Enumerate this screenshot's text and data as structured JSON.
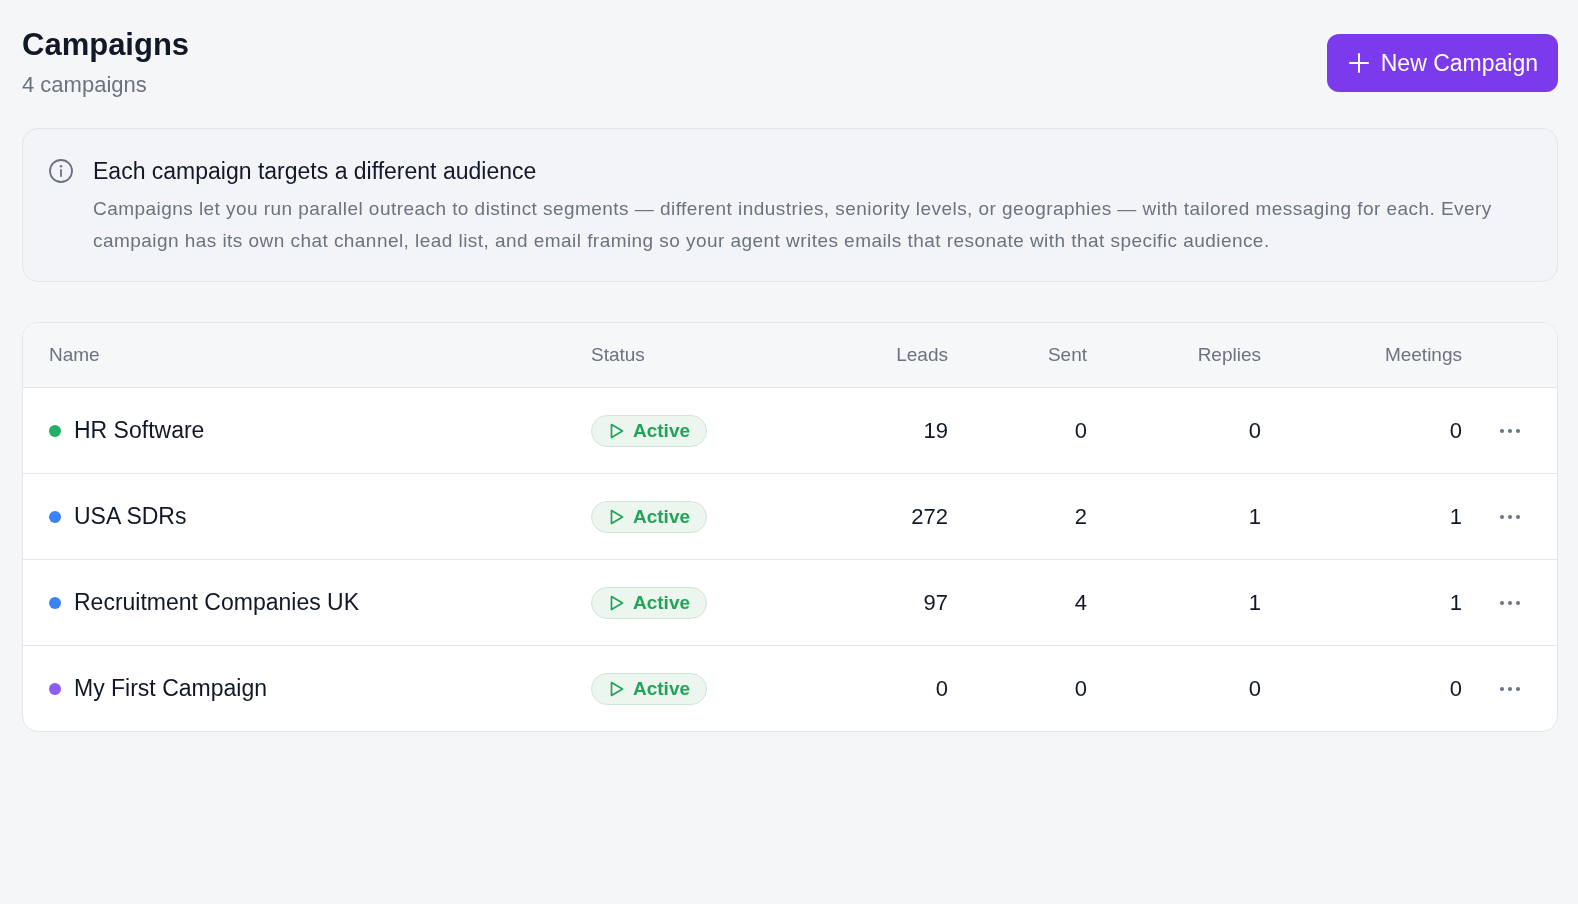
{
  "header": {
    "title": "Campaigns",
    "subtitle": "4 campaigns",
    "new_button": {
      "label": "New Campaign"
    }
  },
  "info_card": {
    "title": "Each campaign targets a different audience",
    "body": "Campaigns let you run parallel outreach to distinct segments — different industries, seniority levels, or geographies — with tailored messaging for each. Every campaign has its own chat channel, lead list, and email framing so your agent writes emails that resonate with that specific audience."
  },
  "table": {
    "columns": [
      "Name",
      "Status",
      "Leads",
      "Sent",
      "Replies",
      "Meetings"
    ],
    "rows": [
      {
        "name": "HR Software",
        "color": "#22b067",
        "status": {
          "kind": "active",
          "label": "Active"
        },
        "leads": "19",
        "sent": "0",
        "replies": "0",
        "meetings": "0"
      },
      {
        "name": "USA SDRs",
        "color": "#3b82f6",
        "status": {
          "kind": "active",
          "label": "Active"
        },
        "leads": "272",
        "sent": "2",
        "replies": "1",
        "meetings": "1"
      },
      {
        "name": "Recruitment Companies UK",
        "color": "#3b82f6",
        "status": {
          "kind": "active",
          "label": "Active"
        },
        "leads": "97",
        "sent": "4",
        "replies": "1",
        "meetings": "1"
      },
      {
        "name": "My First Campaign",
        "color": "#8b5cf6",
        "status": {
          "kind": "active",
          "label": "Active"
        },
        "leads": "0",
        "sent": "0",
        "replies": "0",
        "meetings": "0"
      }
    ]
  }
}
